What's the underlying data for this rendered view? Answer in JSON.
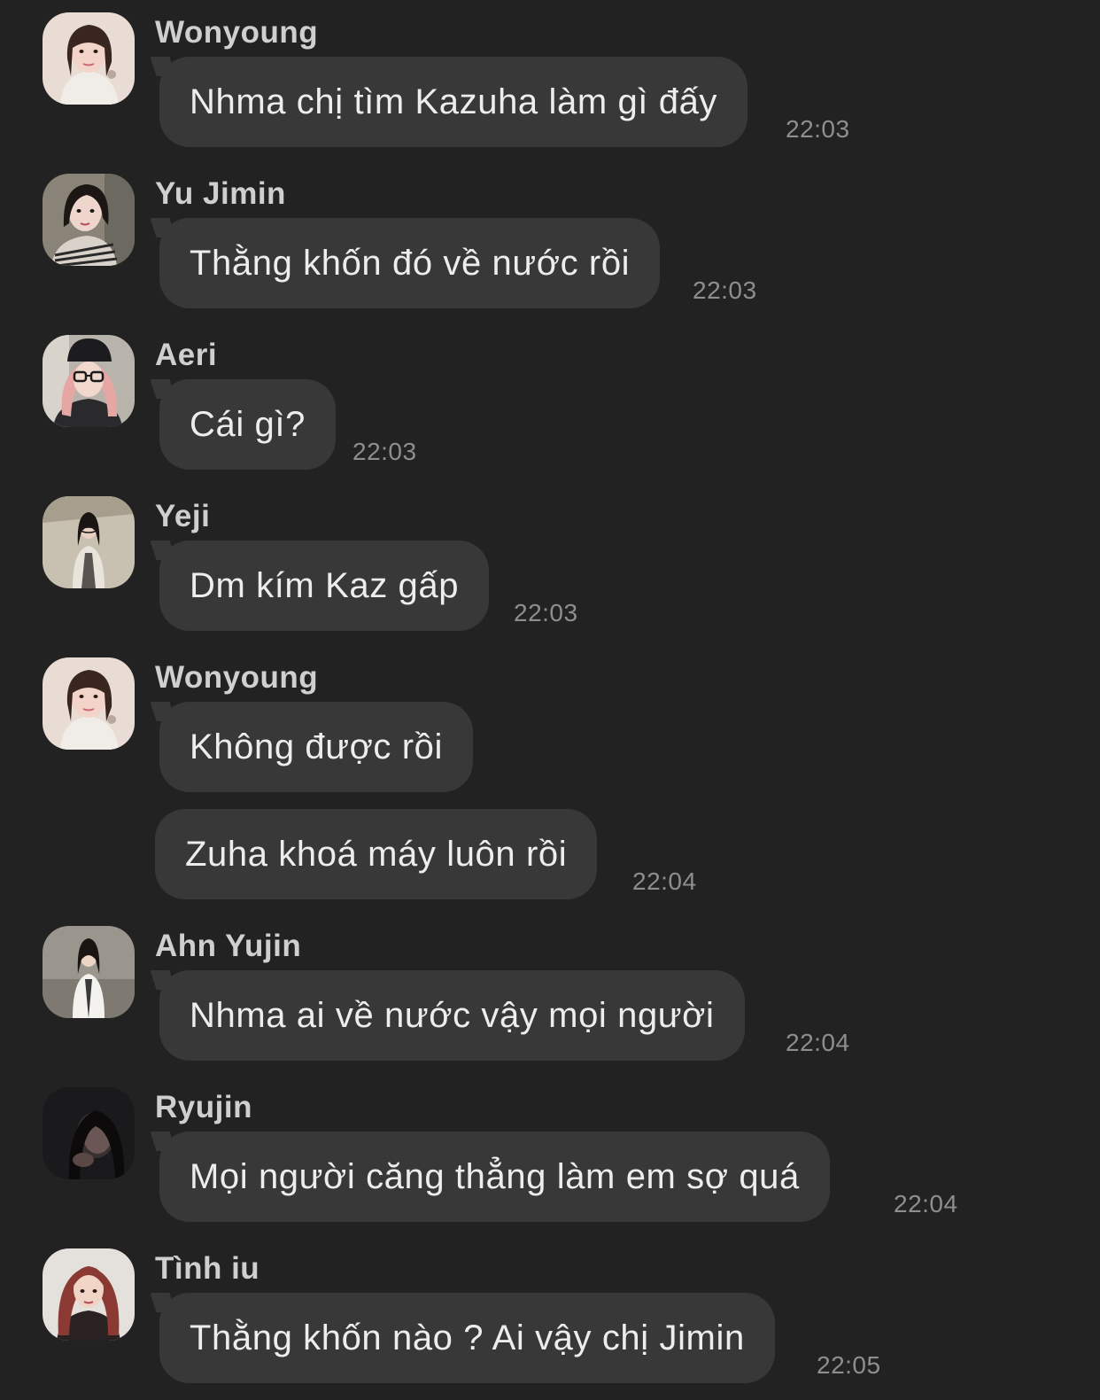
{
  "messages": [
    {
      "sender": "Wonyoung",
      "avatar": "wonyoung-avatar",
      "texts": [
        "Nhma chị tìm Kazuha làm gì đấy"
      ],
      "time": "22:03"
    },
    {
      "sender": "Yu Jimin",
      "avatar": "yu-jimin-avatar",
      "texts": [
        "Thằng khốn đó về nước rồi"
      ],
      "time": "22:03"
    },
    {
      "sender": "Aeri",
      "avatar": "aeri-avatar",
      "texts": [
        "Cái gì?"
      ],
      "time": "22:03"
    },
    {
      "sender": "Yeji",
      "avatar": "yeji-avatar",
      "texts": [
        "Dm kím Kaz gấp"
      ],
      "time": "22:03"
    },
    {
      "sender": "Wonyoung",
      "avatar": "wonyoung-avatar",
      "texts": [
        "Không được rồi",
        "Zuha khoá máy luôn rồi"
      ],
      "time": "22:04"
    },
    {
      "sender": "Ahn Yujin",
      "avatar": "ahn-yujin-avatar",
      "texts": [
        "Nhma ai về nước vậy mọi người"
      ],
      "time": "22:04"
    },
    {
      "sender": "Ryujin",
      "avatar": "ryujin-avatar",
      "texts": [
        "Mọi người căng thẳng làm em sợ quá"
      ],
      "time": "22:04"
    },
    {
      "sender": "Tình iu",
      "avatar": "tinh-iu-avatar",
      "texts": [
        "Thằng khốn nào ? Ai vậy chị Jimin"
      ],
      "time": "22:05"
    }
  ],
  "colors": {
    "background": "#222222",
    "bubble": "#383838",
    "sender": "#cfcfcf",
    "text": "#ededed",
    "time": "#8e8e8e"
  }
}
